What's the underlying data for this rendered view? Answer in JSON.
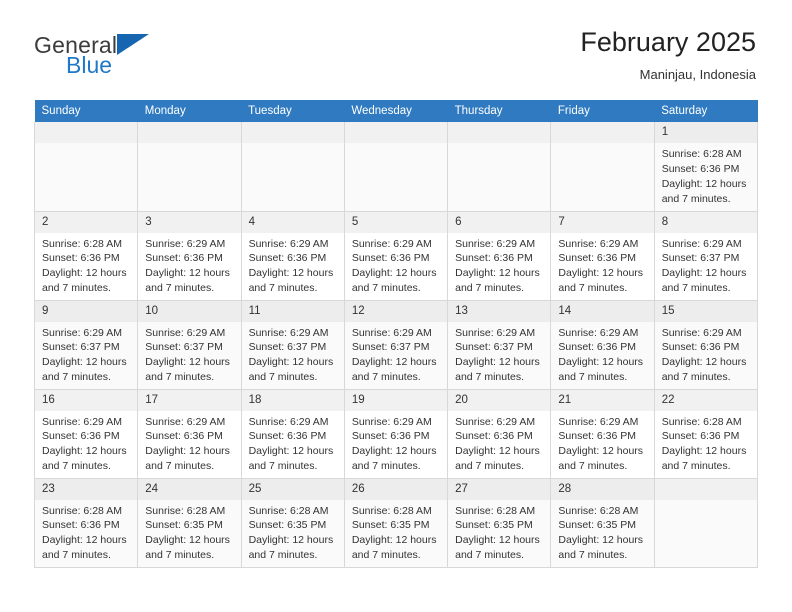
{
  "brand": {
    "word1": "General",
    "word2": "Blue",
    "flag_icon": "triangle-flag-icon",
    "accent_color": "#1565b0",
    "blue_text_color": "#2079c8"
  },
  "header": {
    "title": "February 2025",
    "subtitle": "Maninjau, Indonesia"
  },
  "calendar": {
    "header_bg": "#2f7ac0",
    "weekday_headers": [
      "Sunday",
      "Monday",
      "Tuesday",
      "Wednesday",
      "Thursday",
      "Friday",
      "Saturday"
    ],
    "labels": {
      "sunrise": "Sunrise:",
      "sunset": "Sunset:",
      "daylight": "Daylight:"
    },
    "weeks": [
      [
        {
          "day": "",
          "empty": true,
          "sunrise": "",
          "sunset": "",
          "daylight_line1": "",
          "daylight_line2": ""
        },
        {
          "day": "",
          "empty": true,
          "sunrise": "",
          "sunset": "",
          "daylight_line1": "",
          "daylight_line2": ""
        },
        {
          "day": "",
          "empty": true,
          "sunrise": "",
          "sunset": "",
          "daylight_line1": "",
          "daylight_line2": ""
        },
        {
          "day": "",
          "empty": true,
          "sunrise": "",
          "sunset": "",
          "daylight_line1": "",
          "daylight_line2": ""
        },
        {
          "day": "",
          "empty": true,
          "sunrise": "",
          "sunset": "",
          "daylight_line1": "",
          "daylight_line2": ""
        },
        {
          "day": "",
          "empty": true,
          "sunrise": "",
          "sunset": "",
          "daylight_line1": "",
          "daylight_line2": ""
        },
        {
          "day": "1",
          "empty": false,
          "sunrise": "Sunrise: 6:28 AM",
          "sunset": "Sunset: 6:36 PM",
          "daylight_line1": "Daylight: 12 hours",
          "daylight_line2": "and 7 minutes."
        }
      ],
      [
        {
          "day": "2",
          "empty": false,
          "sunrise": "Sunrise: 6:28 AM",
          "sunset": "Sunset: 6:36 PM",
          "daylight_line1": "Daylight: 12 hours",
          "daylight_line2": "and 7 minutes."
        },
        {
          "day": "3",
          "empty": false,
          "sunrise": "Sunrise: 6:29 AM",
          "sunset": "Sunset: 6:36 PM",
          "daylight_line1": "Daylight: 12 hours",
          "daylight_line2": "and 7 minutes."
        },
        {
          "day": "4",
          "empty": false,
          "sunrise": "Sunrise: 6:29 AM",
          "sunset": "Sunset: 6:36 PM",
          "daylight_line1": "Daylight: 12 hours",
          "daylight_line2": "and 7 minutes."
        },
        {
          "day": "5",
          "empty": false,
          "sunrise": "Sunrise: 6:29 AM",
          "sunset": "Sunset: 6:36 PM",
          "daylight_line1": "Daylight: 12 hours",
          "daylight_line2": "and 7 minutes."
        },
        {
          "day": "6",
          "empty": false,
          "sunrise": "Sunrise: 6:29 AM",
          "sunset": "Sunset: 6:36 PM",
          "daylight_line1": "Daylight: 12 hours",
          "daylight_line2": "and 7 minutes."
        },
        {
          "day": "7",
          "empty": false,
          "sunrise": "Sunrise: 6:29 AM",
          "sunset": "Sunset: 6:36 PM",
          "daylight_line1": "Daylight: 12 hours",
          "daylight_line2": "and 7 minutes."
        },
        {
          "day": "8",
          "empty": false,
          "sunrise": "Sunrise: 6:29 AM",
          "sunset": "Sunset: 6:37 PM",
          "daylight_line1": "Daylight: 12 hours",
          "daylight_line2": "and 7 minutes."
        }
      ],
      [
        {
          "day": "9",
          "empty": false,
          "sunrise": "Sunrise: 6:29 AM",
          "sunset": "Sunset: 6:37 PM",
          "daylight_line1": "Daylight: 12 hours",
          "daylight_line2": "and 7 minutes."
        },
        {
          "day": "10",
          "empty": false,
          "sunrise": "Sunrise: 6:29 AM",
          "sunset": "Sunset: 6:37 PM",
          "daylight_line1": "Daylight: 12 hours",
          "daylight_line2": "and 7 minutes."
        },
        {
          "day": "11",
          "empty": false,
          "sunrise": "Sunrise: 6:29 AM",
          "sunset": "Sunset: 6:37 PM",
          "daylight_line1": "Daylight: 12 hours",
          "daylight_line2": "and 7 minutes."
        },
        {
          "day": "12",
          "empty": false,
          "sunrise": "Sunrise: 6:29 AM",
          "sunset": "Sunset: 6:37 PM",
          "daylight_line1": "Daylight: 12 hours",
          "daylight_line2": "and 7 minutes."
        },
        {
          "day": "13",
          "empty": false,
          "sunrise": "Sunrise: 6:29 AM",
          "sunset": "Sunset: 6:37 PM",
          "daylight_line1": "Daylight: 12 hours",
          "daylight_line2": "and 7 minutes."
        },
        {
          "day": "14",
          "empty": false,
          "sunrise": "Sunrise: 6:29 AM",
          "sunset": "Sunset: 6:36 PM",
          "daylight_line1": "Daylight: 12 hours",
          "daylight_line2": "and 7 minutes."
        },
        {
          "day": "15",
          "empty": false,
          "sunrise": "Sunrise: 6:29 AM",
          "sunset": "Sunset: 6:36 PM",
          "daylight_line1": "Daylight: 12 hours",
          "daylight_line2": "and 7 minutes."
        }
      ],
      [
        {
          "day": "16",
          "empty": false,
          "sunrise": "Sunrise: 6:29 AM",
          "sunset": "Sunset: 6:36 PM",
          "daylight_line1": "Daylight: 12 hours",
          "daylight_line2": "and 7 minutes."
        },
        {
          "day": "17",
          "empty": false,
          "sunrise": "Sunrise: 6:29 AM",
          "sunset": "Sunset: 6:36 PM",
          "daylight_line1": "Daylight: 12 hours",
          "daylight_line2": "and 7 minutes."
        },
        {
          "day": "18",
          "empty": false,
          "sunrise": "Sunrise: 6:29 AM",
          "sunset": "Sunset: 6:36 PM",
          "daylight_line1": "Daylight: 12 hours",
          "daylight_line2": "and 7 minutes."
        },
        {
          "day": "19",
          "empty": false,
          "sunrise": "Sunrise: 6:29 AM",
          "sunset": "Sunset: 6:36 PM",
          "daylight_line1": "Daylight: 12 hours",
          "daylight_line2": "and 7 minutes."
        },
        {
          "day": "20",
          "empty": false,
          "sunrise": "Sunrise: 6:29 AM",
          "sunset": "Sunset: 6:36 PM",
          "daylight_line1": "Daylight: 12 hours",
          "daylight_line2": "and 7 minutes."
        },
        {
          "day": "21",
          "empty": false,
          "sunrise": "Sunrise: 6:29 AM",
          "sunset": "Sunset: 6:36 PM",
          "daylight_line1": "Daylight: 12 hours",
          "daylight_line2": "and 7 minutes."
        },
        {
          "day": "22",
          "empty": false,
          "sunrise": "Sunrise: 6:28 AM",
          "sunset": "Sunset: 6:36 PM",
          "daylight_line1": "Daylight: 12 hours",
          "daylight_line2": "and 7 minutes."
        }
      ],
      [
        {
          "day": "23",
          "empty": false,
          "sunrise": "Sunrise: 6:28 AM",
          "sunset": "Sunset: 6:36 PM",
          "daylight_line1": "Daylight: 12 hours",
          "daylight_line2": "and 7 minutes."
        },
        {
          "day": "24",
          "empty": false,
          "sunrise": "Sunrise: 6:28 AM",
          "sunset": "Sunset: 6:35 PM",
          "daylight_line1": "Daylight: 12 hours",
          "daylight_line2": "and 7 minutes."
        },
        {
          "day": "25",
          "empty": false,
          "sunrise": "Sunrise: 6:28 AM",
          "sunset": "Sunset: 6:35 PM",
          "daylight_line1": "Daylight: 12 hours",
          "daylight_line2": "and 7 minutes."
        },
        {
          "day": "26",
          "empty": false,
          "sunrise": "Sunrise: 6:28 AM",
          "sunset": "Sunset: 6:35 PM",
          "daylight_line1": "Daylight: 12 hours",
          "daylight_line2": "and 7 minutes."
        },
        {
          "day": "27",
          "empty": false,
          "sunrise": "Sunrise: 6:28 AM",
          "sunset": "Sunset: 6:35 PM",
          "daylight_line1": "Daylight: 12 hours",
          "daylight_line2": "and 7 minutes."
        },
        {
          "day": "28",
          "empty": false,
          "sunrise": "Sunrise: 6:28 AM",
          "sunset": "Sunset: 6:35 PM",
          "daylight_line1": "Daylight: 12 hours",
          "daylight_line2": "and 7 minutes."
        },
        {
          "day": "",
          "empty": true,
          "sunrise": "",
          "sunset": "",
          "daylight_line1": "",
          "daylight_line2": ""
        }
      ]
    ]
  }
}
